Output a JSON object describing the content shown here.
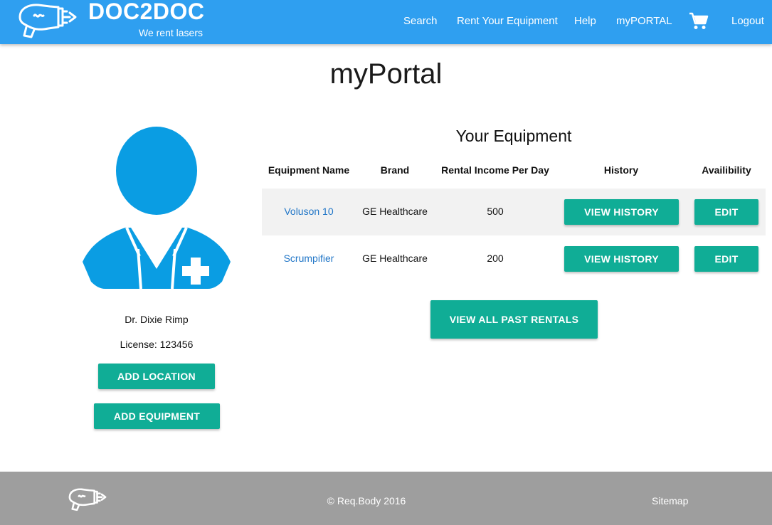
{
  "header": {
    "brand": "DOC2DOC",
    "tagline": "We rent lasers",
    "nav": {
      "search": "Search",
      "rent": "Rent Your Equipment",
      "help": "Help",
      "myportal": "myPORTAL",
      "logout": "Logout"
    },
    "cart_icon": "shopping-cart-icon"
  },
  "page_title": "myPortal",
  "profile": {
    "name": "Dr. Dixie Rimp",
    "license": "License: 123456",
    "add_location_label": "ADD LOCATION",
    "add_equipment_label": "ADD EQUIPMENT"
  },
  "equipment": {
    "title": "Your Equipment",
    "columns": [
      "Equipment Name",
      "Brand",
      "Rental Income Per Day",
      "History",
      "Availibility"
    ],
    "rows": [
      {
        "name": "Voluson 10",
        "brand": "GE Healthcare",
        "income": "500",
        "history_label": "VIEW HISTORY",
        "edit_label": "EDIT"
      },
      {
        "name": "Scrumpifier",
        "brand": "GE Healthcare",
        "income": "200",
        "history_label": "VIEW HISTORY",
        "edit_label": "EDIT"
      }
    ],
    "view_all_label": "VIEW ALL PAST RENTALS"
  },
  "footer": {
    "copyright": "© Req.Body 2016",
    "sitemap": "Sitemap"
  },
  "colors": {
    "header": "#2f9ff0",
    "accent": "#10ad96",
    "link": "#2176c7",
    "avatar": "#0a9de3",
    "footer": "#9e9e9e",
    "row_stripe": "#f2f2f2"
  }
}
